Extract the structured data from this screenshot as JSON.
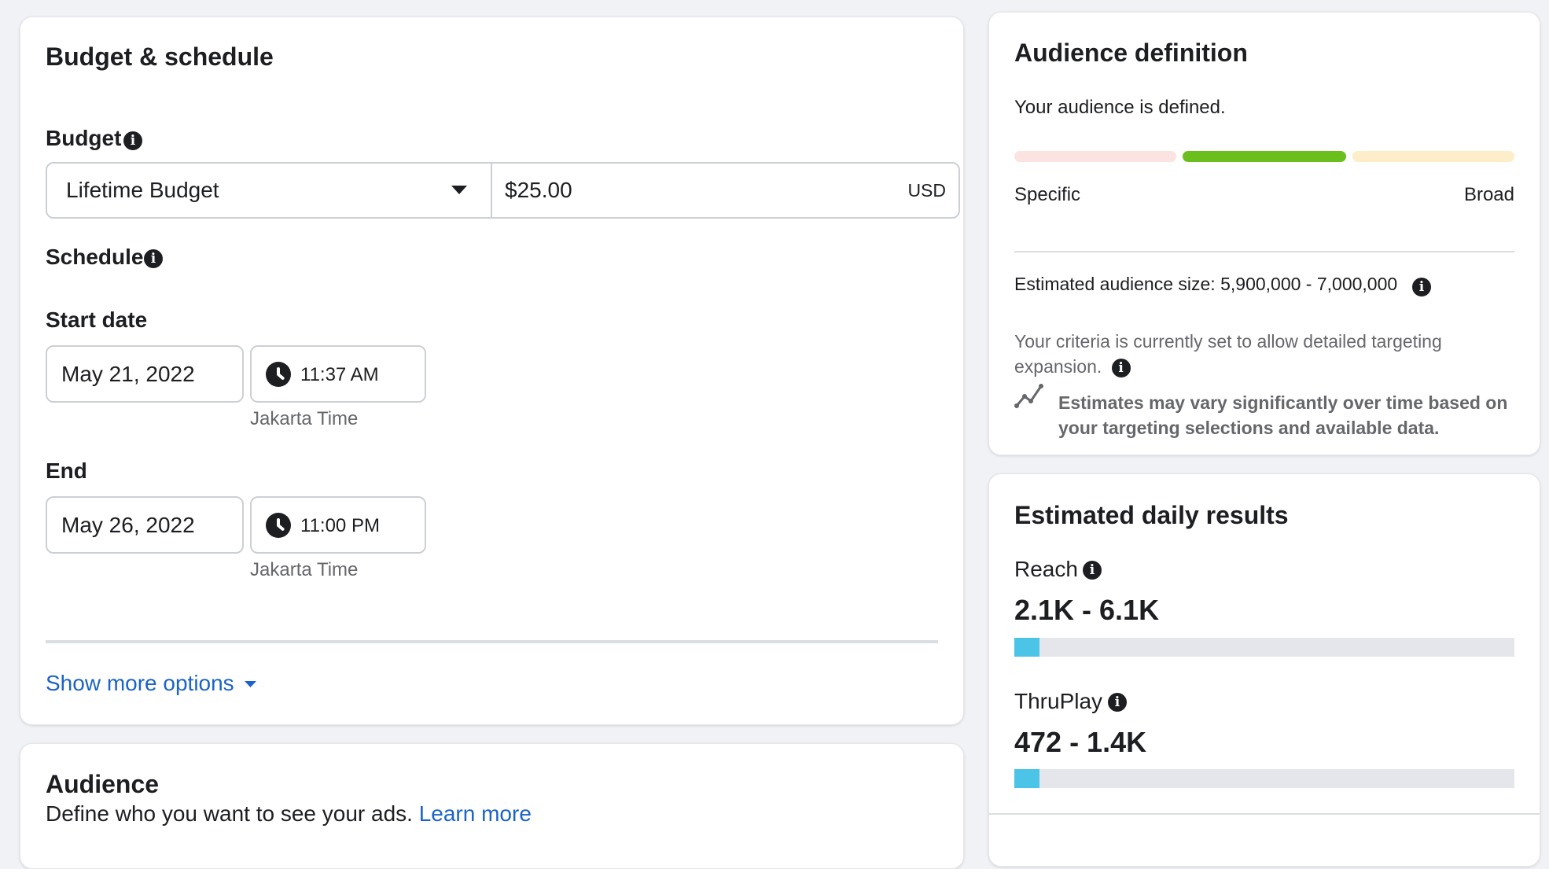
{
  "budget_schedule": {
    "title": "Budget & schedule",
    "budget_label": "Budget",
    "budget_type": "Lifetime Budget",
    "budget_amount": "$25.00",
    "currency": "USD",
    "schedule_label": "Schedule",
    "start": {
      "label": "Start date",
      "date": "May 21, 2022",
      "time": "11:37 AM",
      "timezone": "Jakarta Time"
    },
    "end": {
      "label": "End",
      "date": "May 26, 2022",
      "time": "11:00 PM",
      "timezone": "Jakarta Time"
    },
    "show_more": "Show more options"
  },
  "audience": {
    "title": "Audience",
    "description": "Define who you want to see your ads.",
    "learn_more": "Learn more"
  },
  "audience_definition": {
    "title": "Audience definition",
    "status": "Your audience is defined.",
    "scale_left": "Specific",
    "scale_right": "Broad",
    "active_segment": 2,
    "segment_colors": [
      "#fbe3e1",
      "#6abf1c",
      "#fdedc9"
    ],
    "size_label": "Estimated audience size:",
    "size_value": "5,900,000 - 7,000,000",
    "criteria_note": "Your criteria is currently set to allow detailed targeting expansion.",
    "estimate_note": "Estimates may vary significantly over time based on your targeting selections and available data.",
    "estimate_icon": "trend-line-icon"
  },
  "estimated_results": {
    "title": "Estimated daily results",
    "reach": {
      "label": "Reach",
      "value": "2.1K - 6.1K",
      "fill": 0.05
    },
    "thruplay": {
      "label": "ThruPlay",
      "value": "472 - 1.4K",
      "fill": 0.05
    },
    "accent": "#4cc4e8"
  }
}
